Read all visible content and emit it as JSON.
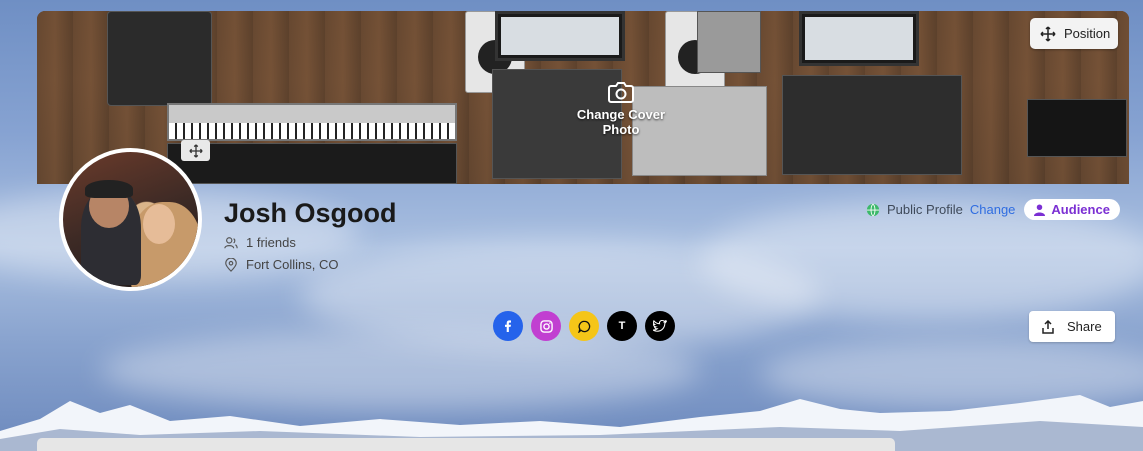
{
  "cover": {
    "position_label": "Position",
    "change_cover_label": "Change Cover Photo"
  },
  "profile": {
    "name": "Josh Osgood",
    "friends": "1 friends",
    "location": "Fort Collins, CO"
  },
  "privacy": {
    "status": "Public Profile",
    "change_label": "Change",
    "audience_label": "Audience"
  },
  "socials": {
    "icons": [
      "facebook-icon",
      "instagram-icon",
      "chat-icon",
      "tiktok-icon",
      "twitter-icon"
    ],
    "tiktok_letter": "T",
    "colors": {
      "facebook": "#2563eb",
      "instagram": "#c13fd1",
      "chat": "#f5c518",
      "tiktok": "#000000",
      "twitter": "#000000"
    }
  },
  "share": {
    "label": "Share"
  }
}
